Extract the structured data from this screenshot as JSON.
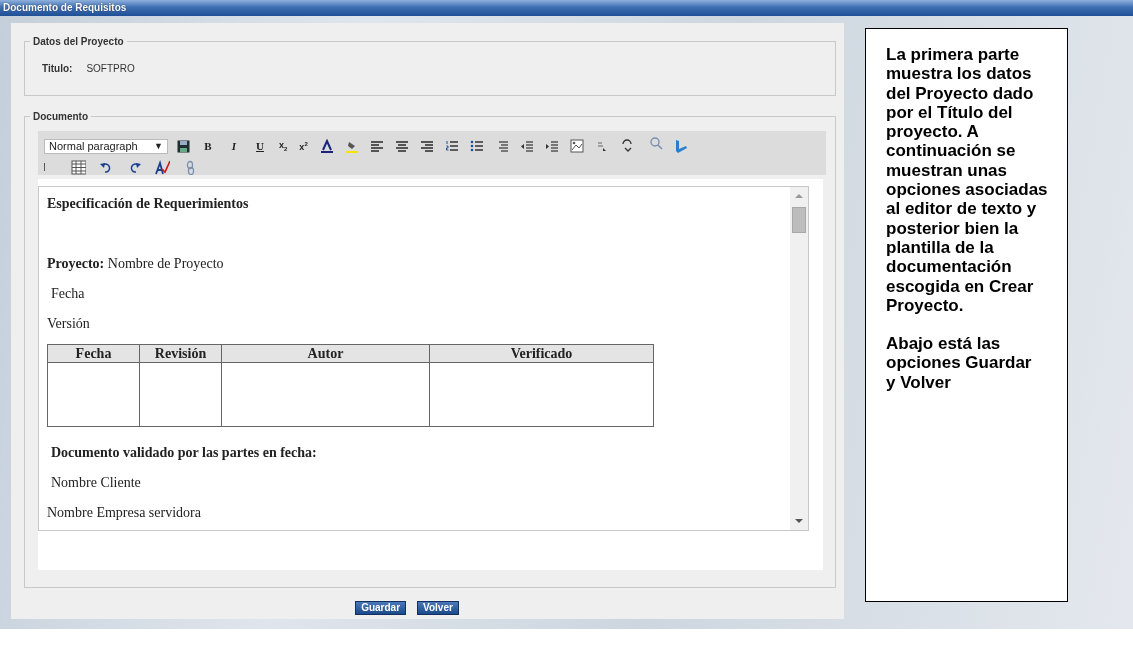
{
  "window": {
    "title": "Documento de Requisitos"
  },
  "project_section": {
    "legend": "Datos del Proyecto",
    "field_label": "Titulo:",
    "field_value": "SOFTPRO"
  },
  "document_section": {
    "legend": "Documento"
  },
  "toolbar": {
    "style_select": {
      "value": "Normal paragraph",
      "arrow": "▼"
    },
    "format_buttons": [
      {
        "kind": "bold",
        "label": "B"
      },
      {
        "kind": "italic",
        "label": "I"
      },
      {
        "kind": "underline",
        "label": "U"
      },
      {
        "kind": "subscript",
        "label": "x$_{2}$"
      },
      {
        "kind": "superscript",
        "label": "x$^{2}$"
      }
    ]
  },
  "editor": {
    "paragraphs": [
      {
        "kind": "heading",
        "text": "Especificación de Requerimientos"
      },
      {
        "kind": "spacer"
      },
      {
        "kind": "normal",
        "text": "**Proyecto:** Nombre de Proyecto"
      },
      {
        "kind": "indented",
        "text": "Fecha"
      },
      {
        "kind": "normal",
        "text": "Versión"
      },
      {
        "kind": "table",
        "columns": [
          "Fecha",
          "Revisión",
          "Autor",
          "Verificado"
        ]
      },
      {
        "kind": "heading-indented",
        "text": "Documento validado por las partes en fecha:"
      },
      {
        "kind": "indented",
        "text": "Nombre Cliente"
      },
      {
        "kind": "normal",
        "text": "Nombre Empresa servidora"
      }
    ]
  },
  "buttons": [
    "Guardar",
    "Volver"
  ],
  "callout": {
    "paragraphs": [
      "La primera parte muestra los datos del Proyecto dado por el Título del proyecto. A continuación se muestran unas opciones asociadas al editor de texto y posterior bien la plantilla de la documentación escogida en Crear Proyecto.",
      "Abajo está las opciones Guardar  y Volver"
    ]
  }
}
